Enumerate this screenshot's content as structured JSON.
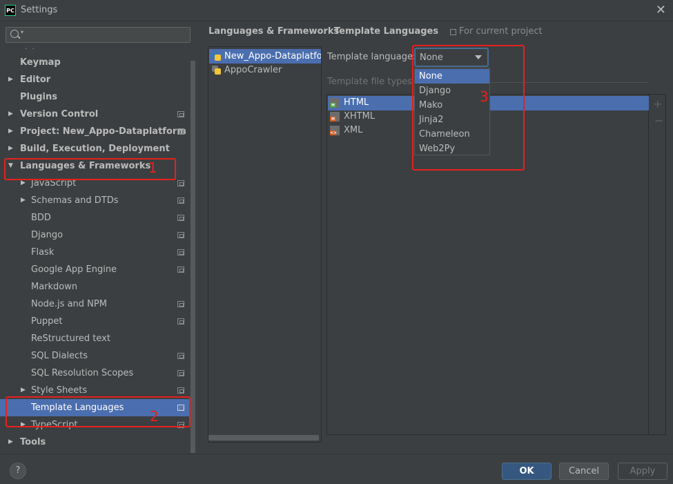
{
  "window": {
    "title": "Settings",
    "logo_text": "PC"
  },
  "search": {
    "value": "",
    "placeholder": ""
  },
  "tree": {
    "ellipsis": "· ·",
    "items": [
      {
        "label": "Keymap",
        "level": 0,
        "bold": true,
        "arrow": ""
      },
      {
        "label": "Editor",
        "level": 0,
        "bold": true,
        "arrow": "▶"
      },
      {
        "label": "Plugins",
        "level": 0,
        "bold": true,
        "arrow": ""
      },
      {
        "label": "Version Control",
        "level": 0,
        "bold": true,
        "arrow": "▶"
      },
      {
        "label": "Project: New_Appo-Dataplatform",
        "level": 0,
        "bold": true,
        "arrow": "▶"
      },
      {
        "label": "Build, Execution, Deployment",
        "level": 0,
        "bold": true,
        "arrow": "▶"
      },
      {
        "label": "Languages & Frameworks",
        "level": 0,
        "bold": true,
        "arrow": "▼"
      },
      {
        "label": "JavaScript",
        "level": 1,
        "arrow": "▶"
      },
      {
        "label": "Schemas and DTDs",
        "level": 1,
        "arrow": "▶"
      },
      {
        "label": "BDD",
        "level": 1,
        "arrow": ""
      },
      {
        "label": "Django",
        "level": 1,
        "arrow": ""
      },
      {
        "label": "Flask",
        "level": 1,
        "arrow": ""
      },
      {
        "label": "Google App Engine",
        "level": 1,
        "arrow": ""
      },
      {
        "label": "Markdown",
        "level": 1,
        "arrow": ""
      },
      {
        "label": "Node.js and NPM",
        "level": 1,
        "arrow": ""
      },
      {
        "label": "Puppet",
        "level": 1,
        "arrow": ""
      },
      {
        "label": "ReStructured text",
        "level": 1,
        "arrow": ""
      },
      {
        "label": "SQL Dialects",
        "level": 1,
        "arrow": ""
      },
      {
        "label": "SQL Resolution Scopes",
        "level": 1,
        "arrow": ""
      },
      {
        "label": "Style Sheets",
        "level": 1,
        "arrow": "▶"
      },
      {
        "label": "Template Languages",
        "level": 1,
        "arrow": "",
        "selected": true
      },
      {
        "label": "TypeScript",
        "level": 1,
        "arrow": "▶"
      },
      {
        "label": "Tools",
        "level": 0,
        "bold": true,
        "arrow": "▶"
      }
    ]
  },
  "breadcrumb": {
    "parent": "Languages & Frameworks",
    "separator": "›",
    "current": "Template Languages",
    "scope": "For current project"
  },
  "projects": [
    {
      "label": "New_Appo-Dataplatform",
      "selected": true
    },
    {
      "label": "AppoCrawler",
      "selected": false
    }
  ],
  "template_language": {
    "label": "Template language:",
    "value": "None",
    "options": [
      "None",
      "Django",
      "Mako",
      "Jinja2",
      "Chameleon",
      "Web2Py"
    ]
  },
  "file_types": {
    "label": "Template file types",
    "items": [
      {
        "label": "HTML",
        "tag": "H",
        "tag_color": "#4a9c4a",
        "selected": true
      },
      {
        "label": "XHTML",
        "tag": "H",
        "tag_color": "#d35a1f",
        "selected": false
      },
      {
        "label": "XML",
        "tag": "<>",
        "tag_color": "#d35a1f",
        "selected": false
      }
    ],
    "add": "+",
    "remove": "−"
  },
  "buttons": {
    "help": "?",
    "ok": "OK",
    "cancel": "Cancel",
    "apply": "Apply"
  },
  "annotations": {
    "one": "1",
    "two": "2",
    "three": "3",
    "color": "#e8201c"
  }
}
